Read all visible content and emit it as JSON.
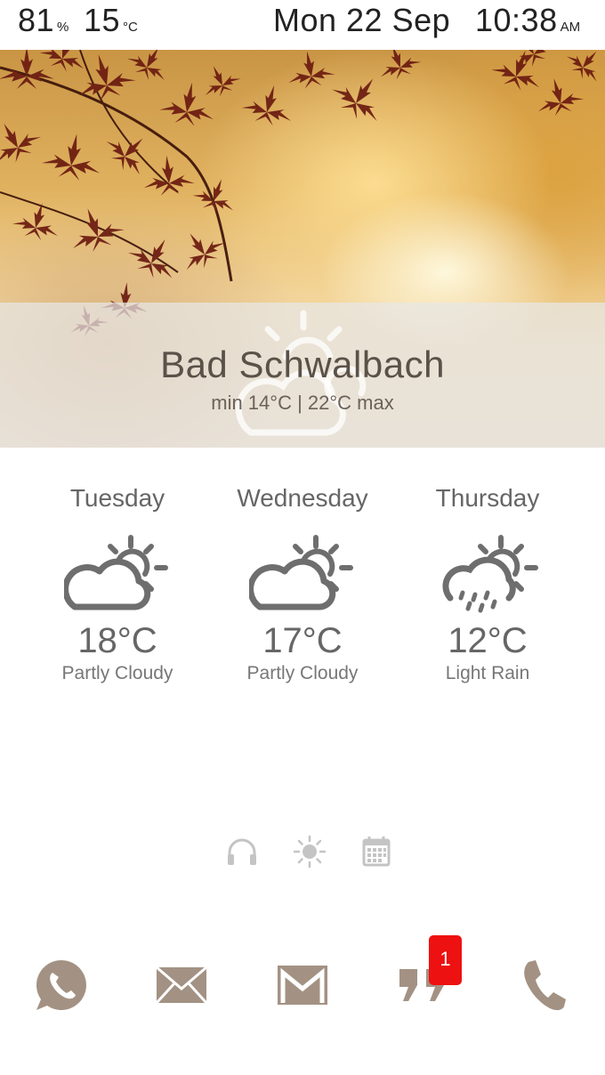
{
  "status_bar": {
    "battery_value": "81",
    "battery_unit": "%",
    "temperature_value": "15",
    "temperature_unit": "°C",
    "date": "Mon 22 Sep",
    "time": "10:38",
    "ampm": "AM"
  },
  "current_weather": {
    "city": "Bad Schwalbach",
    "min_max": "min 14°C | 22°C max",
    "icon": "partly-cloudy-icon"
  },
  "forecast": [
    {
      "day": "Tuesday",
      "temp": "18°C",
      "condition": "Partly Cloudy",
      "icon": "partly-cloudy-icon"
    },
    {
      "day": "Wednesday",
      "temp": "17°C",
      "condition": "Partly Cloudy",
      "icon": "partly-cloudy-icon"
    },
    {
      "day": "Thursday",
      "temp": "12°C",
      "condition": "Light Rain",
      "icon": "light-rain-icon"
    }
  ],
  "quick_actions": [
    "headphones-icon",
    "brightness-icon",
    "calendar-icon"
  ],
  "dock": {
    "items": [
      "whatsapp-icon",
      "email-icon",
      "gmail-icon",
      "messages-icon",
      "phone-icon"
    ],
    "messages_badge": "1"
  },
  "colors": {
    "icon_gray": "#6e6e6e",
    "dock_taupe": "#a39283",
    "quick_gray": "#c4c4c4",
    "badge_red": "#ee1111"
  }
}
